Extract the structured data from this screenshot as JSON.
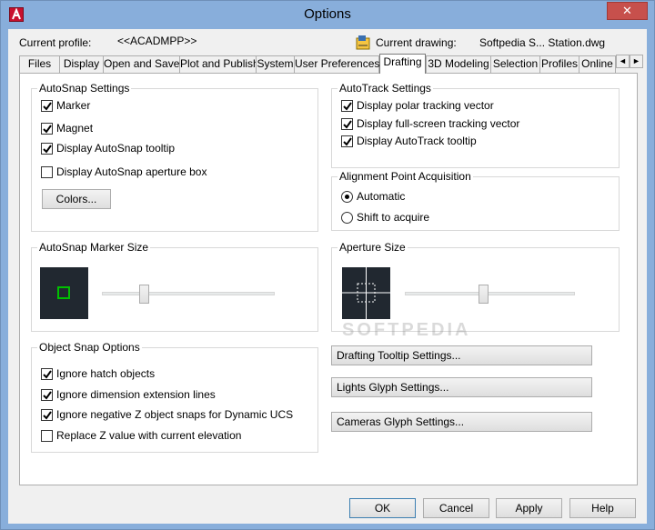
{
  "window": {
    "title": "Options",
    "close_glyph": "✕",
    "app_icon": "autocad-logo-icon"
  },
  "profile": {
    "current_profile_label": "Current profile:",
    "current_profile_value": "<<ACADMPP>>",
    "current_drawing_label": "Current drawing:",
    "current_drawing_value": "Softpedia S... Station.dwg",
    "drawing_icon": "drawing-file-icon"
  },
  "tabs": [
    {
      "label": "Files"
    },
    {
      "label": "Display"
    },
    {
      "label": "Open and Save"
    },
    {
      "label": "Plot and Publish"
    },
    {
      "label": "System"
    },
    {
      "label": "User Preferences"
    },
    {
      "label": "Drafting",
      "active": true
    },
    {
      "label": "3D Modeling"
    },
    {
      "label": "Selection"
    },
    {
      "label": "Profiles"
    },
    {
      "label": "Online"
    }
  ],
  "tab_scroll": {
    "left": "◄",
    "right": "►"
  },
  "autosnap": {
    "title": "AutoSnap Settings",
    "marker": {
      "label": "Marker",
      "checked": true
    },
    "magnet": {
      "label": "Magnet",
      "checked": true
    },
    "tooltip": {
      "label": "Display AutoSnap tooltip",
      "checked": true
    },
    "aperture": {
      "label": "Display AutoSnap aperture box",
      "checked": false
    },
    "colors_button": "Colors..."
  },
  "autotrack": {
    "title": "AutoTrack Settings",
    "polar": {
      "label": "Display polar tracking vector",
      "checked": true
    },
    "fullscreen": {
      "label": "Display full-screen tracking vector",
      "checked": true
    },
    "tooltip": {
      "label": "Display AutoTrack tooltip",
      "checked": true
    }
  },
  "alignment": {
    "title": "Alignment Point Acquisition",
    "automatic": {
      "label": "Automatic",
      "selected": true
    },
    "shift": {
      "label": "Shift to acquire",
      "selected": false
    }
  },
  "marker_size": {
    "title": "AutoSnap Marker Size",
    "slider_fraction": 0.23
  },
  "aperture_size": {
    "title": "Aperture Size",
    "slider_fraction": 0.46
  },
  "object_snap": {
    "title": "Object Snap Options",
    "hatch": {
      "label": "Ignore hatch objects",
      "checked": true
    },
    "dimension": {
      "label": "Ignore dimension extension lines",
      "checked": true
    },
    "negative_z": {
      "label": "Ignore negative Z object snaps for Dynamic UCS",
      "checked": true
    },
    "replace_z": {
      "label": "Replace Z value with current elevation",
      "checked": false
    }
  },
  "settings_buttons": {
    "tooltip": "Drafting Tooltip Settings...",
    "lights": "Lights Glyph Settings...",
    "cameras": "Cameras Glyph Settings..."
  },
  "footer": {
    "ok": "OK",
    "cancel": "Cancel",
    "apply": "Apply",
    "help": "Help"
  },
  "watermark": "SOFTPEDIA",
  "colors": {
    "titlebar": "#88aedb",
    "close": "#c7504c",
    "preview_bg": "#212830",
    "marker_green": "#00c000"
  }
}
